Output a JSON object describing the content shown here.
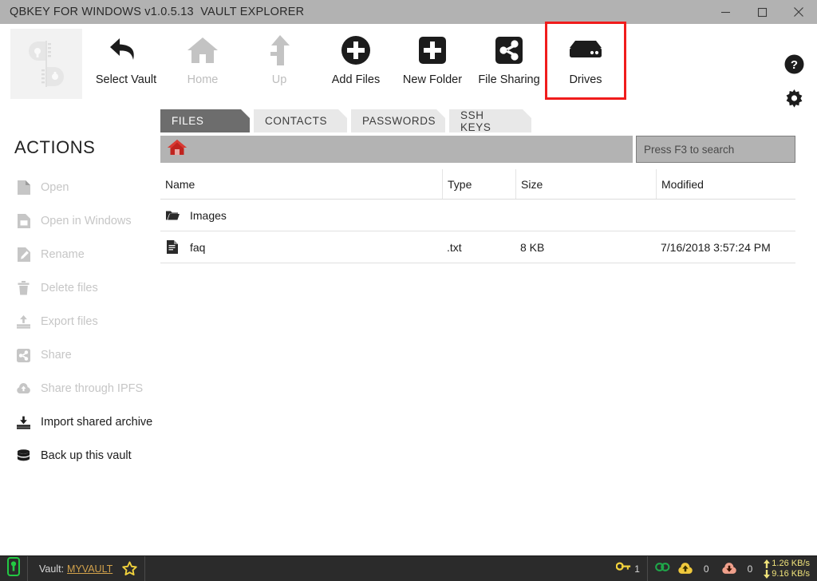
{
  "window": {
    "title": "QBKEY FOR WINDOWS v1.0.5.13  VAULT EXPLORER",
    "controls": [
      {
        "name": "minimize-button",
        "glyph": "minimize"
      },
      {
        "name": "maximize-button",
        "glyph": "maximize"
      },
      {
        "name": "close-button",
        "glyph": "close"
      }
    ]
  },
  "toolbar": {
    "logo_name": "qbkey-logo",
    "items": [
      {
        "label": "Select Vault",
        "icon": "back-arrow-icon",
        "enabled": true,
        "highlighted": false
      },
      {
        "label": "Home",
        "icon": "home-icon",
        "enabled": false,
        "highlighted": false
      },
      {
        "label": "Up",
        "icon": "up-arrow-icon",
        "enabled": false,
        "highlighted": false
      },
      {
        "label": "Add Files",
        "icon": "plus-circle-icon",
        "enabled": true,
        "highlighted": false
      },
      {
        "label": "New Folder",
        "icon": "plus-square-icon",
        "enabled": true,
        "highlighted": false
      },
      {
        "label": "File Sharing",
        "icon": "share-icon",
        "enabled": true,
        "highlighted": false
      },
      {
        "label": "Drives",
        "icon": "drive-icon",
        "enabled": true,
        "highlighted": true
      }
    ],
    "highlight_color": "#f01c1c",
    "help_icon": "help-circle-icon",
    "settings_icon": "gear-icon"
  },
  "sidebar": {
    "title": "ACTIONS",
    "items": [
      {
        "label": "Open",
        "icon": "document-icon",
        "enabled": false
      },
      {
        "label": "Open in Windows",
        "icon": "document-window-icon",
        "enabled": false
      },
      {
        "label": "Rename",
        "icon": "rename-pencil-icon",
        "enabled": false
      },
      {
        "label": "Delete files",
        "icon": "trash-icon",
        "enabled": false
      },
      {
        "label": "Export files",
        "icon": "export-up-icon",
        "enabled": false
      },
      {
        "label": "Share",
        "icon": "share-box-icon",
        "enabled": false
      },
      {
        "label": "Share through IPFS",
        "icon": "cloud-up-icon",
        "enabled": false
      },
      {
        "label": "Import shared archive",
        "icon": "import-down-icon",
        "enabled": true
      },
      {
        "label": "Back up this vault",
        "icon": "database-icon",
        "enabled": true
      }
    ]
  },
  "tabs": [
    {
      "label": "FILES",
      "active": true
    },
    {
      "label": "CONTACTS",
      "active": false
    },
    {
      "label": "PASSWORDS",
      "active": false
    },
    {
      "label": "SSH KEYS",
      "active": false
    }
  ],
  "pathbar": {
    "home_icon": "home-red-icon",
    "path": ""
  },
  "search": {
    "placeholder": "Press F3 to search",
    "value": ""
  },
  "filetable": {
    "columns": [
      "Name",
      "Type",
      "Size",
      "Modified"
    ],
    "rows": [
      {
        "icon": "folder-icon",
        "name": "Images",
        "type": "",
        "size": "",
        "modified": ""
      },
      {
        "icon": "file-txt-icon",
        "name": "faq",
        "type": ".txt",
        "size": "8 KB",
        "modified": "7/16/2018 3:57:24 PM"
      }
    ]
  },
  "statusbar": {
    "device_icon": "usb-key-green-icon",
    "vault_label": "Vault:",
    "vault_name": "MYVAULT",
    "favorite_icon": "star-icon",
    "key_icon": "key-icon",
    "key_count": "1",
    "link_icon": "chain-link-icon",
    "upload_icon": "cloud-up-icon",
    "upload_count": "0",
    "download_icon": "cloud-down-icon",
    "download_count": "0",
    "up_speed": "1.26 KB/s",
    "down_speed": "9.16 KB/s"
  }
}
